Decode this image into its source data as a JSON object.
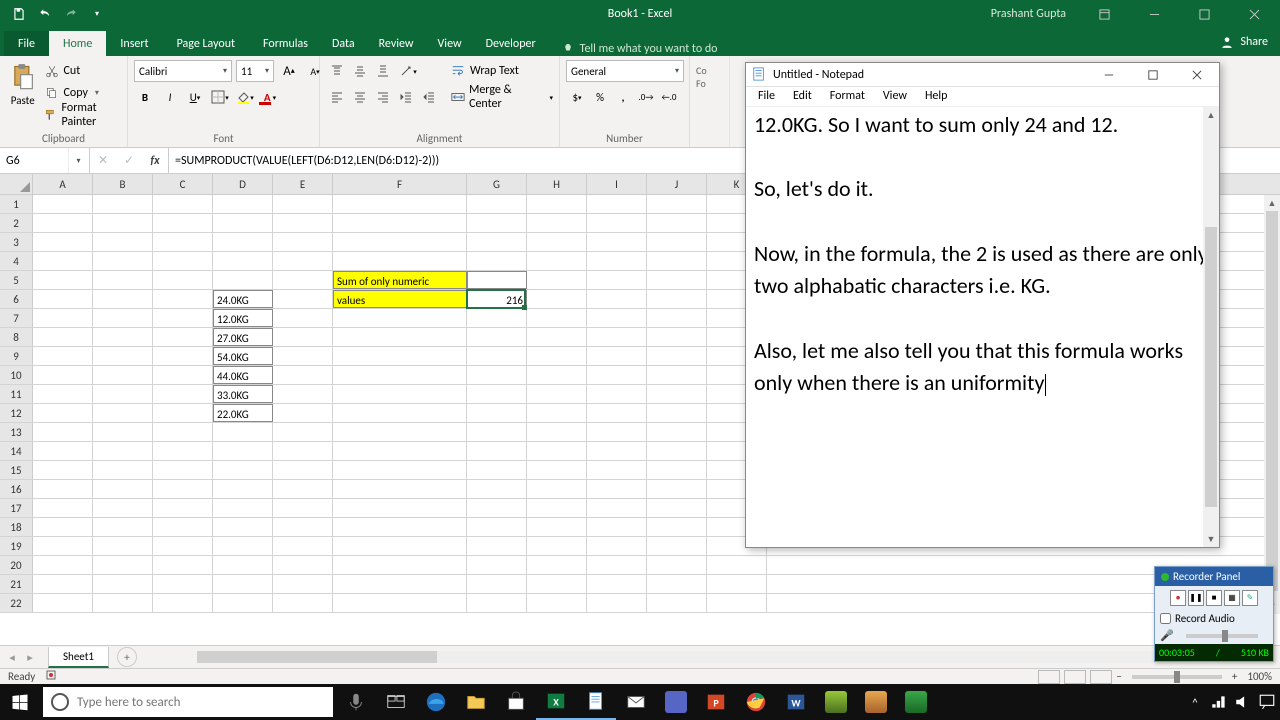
{
  "titlebar": {
    "doc_title": "Book1 - Excel",
    "user": "Prashant Gupta"
  },
  "tabs": {
    "file": "File",
    "home": "Home",
    "insert": "Insert",
    "pagelayout": "Page Layout",
    "formulas": "Formulas",
    "data": "Data",
    "review": "Review",
    "view": "View",
    "developer": "Developer",
    "tellme": "Tell me what you want to do",
    "share": "Share"
  },
  "ribbon": {
    "clipboard": {
      "paste": "Paste",
      "cut": "Cut",
      "copy": "Copy",
      "fmtpainter": "Format Painter",
      "label": "Clipboard"
    },
    "font": {
      "name": "Calibri",
      "size": "11",
      "label": "Font"
    },
    "alignment": {
      "wrap": "Wrap Text",
      "merge": "Merge & Center",
      "label": "Alignment"
    },
    "number": {
      "format": "General",
      "label": "Number"
    }
  },
  "formulabar": {
    "cellref": "G6",
    "formula": "=SUMPRODUCT(VALUE(LEFT(D6:D12,LEN(D6:D12)-2)))"
  },
  "cols": [
    "A",
    "B",
    "C",
    "D",
    "E",
    "F",
    "G",
    "H",
    "I",
    "J",
    "K"
  ],
  "rows": [
    "1",
    "2",
    "3",
    "4",
    "5",
    "6",
    "7",
    "8",
    "9",
    "10",
    "11",
    "12",
    "13",
    "14",
    "15",
    "16",
    "17",
    "18",
    "19",
    "20",
    "21",
    "22"
  ],
  "sheetdata": {
    "d6": "24.0KG",
    "d7": "12.0KG",
    "d8": "27.0KG",
    "d9": "54.0KG",
    "d10": "44.0KG",
    "d11": "33.0KG",
    "d12": "22.0KG",
    "f5": "Sum of only numeric",
    "f6": "values",
    "g6": "216"
  },
  "sheettab": {
    "name": "Sheet1"
  },
  "statusbar": {
    "ready": "Ready",
    "zoom": "100%"
  },
  "notepad": {
    "title": "Untitled - Notepad",
    "menu": {
      "file": "File",
      "edit": "Edit",
      "format": "Format",
      "view": "View",
      "help": "Help"
    },
    "text": "12.0KG. So I want to sum only 24 and 12.\n\nSo, let's do it.\n\nNow, in the formula, the 2 is used as there are only two alphabatic characters i.e. KG.\n\nAlso, let me also tell you that this formula works only when there is an uniformity"
  },
  "recorder": {
    "title": "Recorder Panel",
    "audio": "Record Audio",
    "time": "00:03:05",
    "size": "510 KB"
  },
  "taskbar": {
    "search_placeholder": "Type here to search",
    "time": "",
    "date": ""
  }
}
